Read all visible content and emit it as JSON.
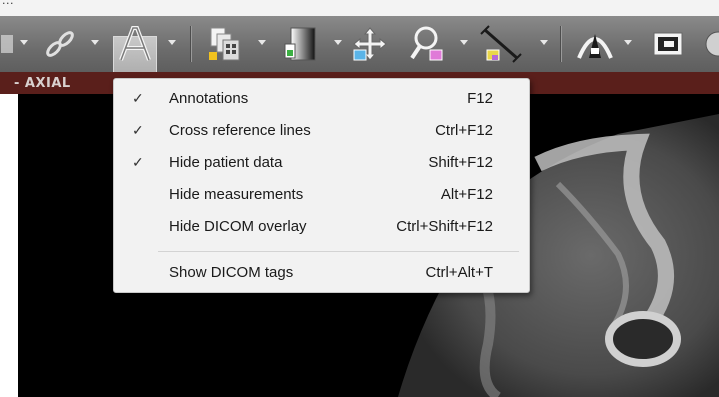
{
  "window": {
    "title": "..."
  },
  "toolbar": {
    "buttons": [
      {
        "name": "link-icon"
      },
      {
        "name": "annotation-text-icon",
        "active": true
      },
      {
        "name": "layout-icon"
      },
      {
        "name": "window-level-icon"
      },
      {
        "name": "pan-icon"
      },
      {
        "name": "zoom-icon"
      },
      {
        "name": "measure-ruler-icon"
      },
      {
        "name": "volume-render-icon"
      },
      {
        "name": "movie-icon"
      }
    ]
  },
  "viewport": {
    "label": "AXIAL"
  },
  "menu": {
    "items": [
      {
        "label": "Annotations",
        "shortcut": "F12",
        "checked": true
      },
      {
        "label": "Cross reference lines",
        "shortcut": "Ctrl+F12",
        "checked": true
      },
      {
        "label": "Hide patient data",
        "shortcut": "Shift+F12",
        "checked": true
      },
      {
        "label": "Hide measurements",
        "shortcut": "Alt+F12",
        "checked": false
      },
      {
        "label": "Hide DICOM overlay",
        "shortcut": "Ctrl+Shift+F12",
        "checked": false
      }
    ],
    "extra": {
      "label": "Show DICOM tags",
      "shortcut": "Ctrl+Alt+T"
    },
    "check_glyph": "✓"
  },
  "colors": {
    "tab_strip": "#5a1f1b",
    "menu_bg": "#f2f2f2",
    "toolbar": "#6c6c6c"
  }
}
